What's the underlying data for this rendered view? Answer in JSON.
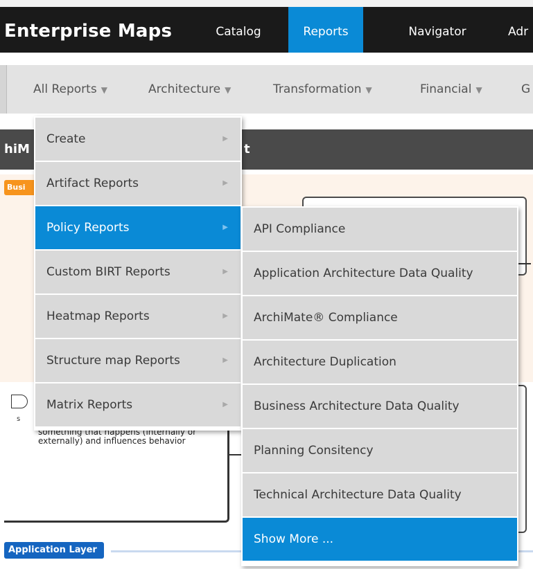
{
  "app": {
    "title": "Enterprise Maps"
  },
  "nav": {
    "items": [
      {
        "label": "Catalog"
      },
      {
        "label": "Reports"
      },
      {
        "label": "Navigator"
      },
      {
        "label": "Adr"
      }
    ],
    "active": "Reports"
  },
  "subnav": {
    "items": [
      {
        "label": "All Reports"
      },
      {
        "label": "Architecture"
      },
      {
        "label": "Transformation"
      },
      {
        "label": "Financial"
      },
      {
        "label": "G"
      }
    ],
    "caret_icon": "triangle-down-icon"
  },
  "background": {
    "section_title_left": "hiM",
    "section_title_right": "t",
    "business_chip": "Busi",
    "event_small": "s",
    "event_description": "something that happens (internally or externally) and influences behavior",
    "application_chip": "Application Layer"
  },
  "menu": {
    "items": [
      {
        "label": "Create"
      },
      {
        "label": "Artifact Reports"
      },
      {
        "label": "Policy Reports"
      },
      {
        "label": "Custom BIRT Reports"
      },
      {
        "label": "Heatmap Reports"
      },
      {
        "label": "Structure map Reports"
      },
      {
        "label": "Matrix Reports"
      }
    ],
    "active": "Policy Reports",
    "submenu_arrow_icon": "triangle-right-icon"
  },
  "submenu": {
    "items": [
      {
        "label": "API Compliance"
      },
      {
        "label": "Application Architecture Data Quality"
      },
      {
        "label": "ArchiMate® Compliance"
      },
      {
        "label": "Architecture Duplication"
      },
      {
        "label": "Business Architecture Data Quality"
      },
      {
        "label": "Planning Consitency"
      },
      {
        "label": "Technical Architecture Data Quality"
      },
      {
        "label": "Show More ..."
      }
    ],
    "active": "Show More ..."
  },
  "colors": {
    "accent": "#0a8ad6",
    "topbar": "#1a1a1a",
    "menu_item": "#d9d9d9",
    "business_layer": "#f7941d",
    "application_layer": "#1565c0"
  }
}
